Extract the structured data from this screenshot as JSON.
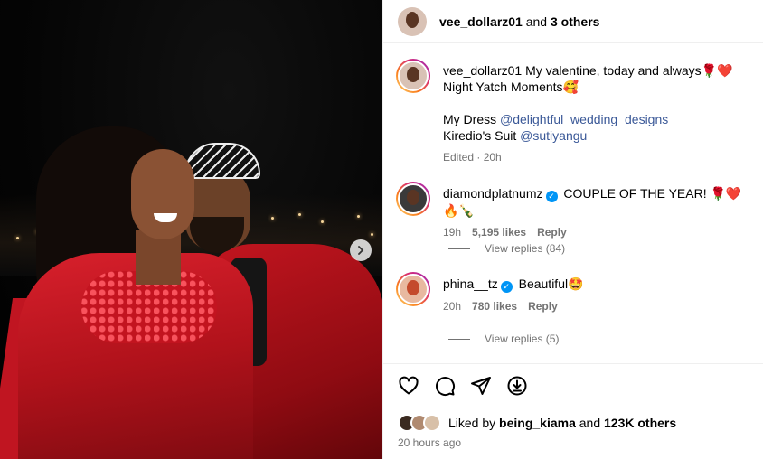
{
  "post": {
    "header": {
      "username": "vee_dollarz01",
      "and_text": "and",
      "others_text": "3 others"
    },
    "caption": {
      "username": "vee_dollarz01",
      "line1": "My valentine, today and always🌹❤️",
      "line2": "Night Yatch Moments🥰",
      "dress_label": "My Dress",
      "dress_tag": "@delightful_wedding_designs",
      "suit_label": "Kiredio's Suit",
      "suit_tag": "@sutiyangu",
      "edited": "Edited · 20h"
    },
    "comments": [
      {
        "username": "diamondplatnumz",
        "verified": "✓",
        "text": "COUPLE OF THE YEAR! 🌹❤️🔥🍾",
        "time": "19h",
        "likes": "5,195 likes",
        "reply": "Reply",
        "view_replies": "View replies (84)"
      },
      {
        "username": "phina__tz",
        "verified": "✓",
        "text": "Beautiful🤩",
        "time": "20h",
        "likes": "780 likes",
        "reply": "Reply",
        "view_replies": "View replies (5)"
      }
    ],
    "likes": {
      "prefix": "Liked by",
      "user": "being_kiama",
      "and": "and",
      "count": "123K others"
    },
    "timestamp": "20 hours ago"
  },
  "icons": [
    "like-heart-icon",
    "comment-icon",
    "share-icon",
    "save-icon",
    "chevron-right-icon"
  ],
  "colors": {
    "link": "#3b5998",
    "verified": "#0095f6",
    "muted": "#737373",
    "dress_red": "#c01521"
  }
}
